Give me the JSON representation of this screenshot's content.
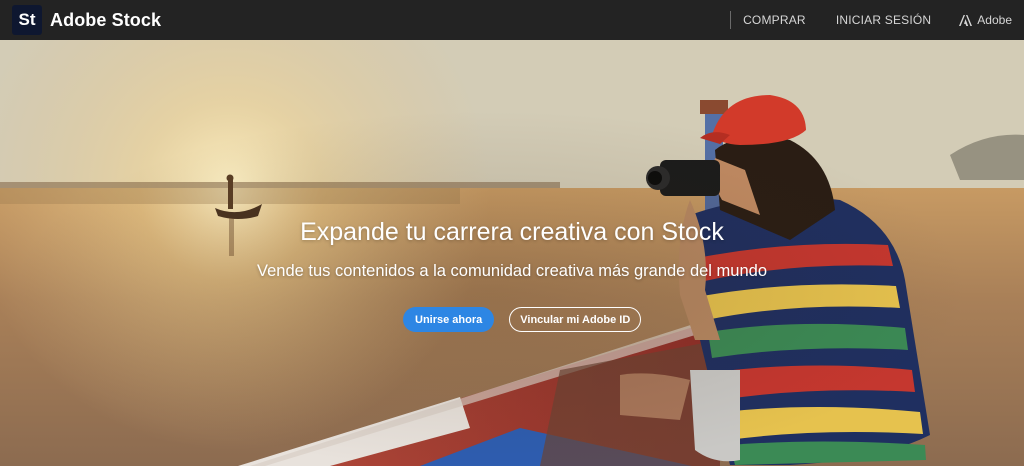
{
  "header": {
    "logo_mark": "St",
    "brand_name": "Adobe Stock",
    "nav": {
      "buy_label": "COMPRAR",
      "signin_label": "INICIAR SESIÓN",
      "adobe_label": "Adobe"
    }
  },
  "hero": {
    "headline": "Expande tu carrera creativa con Stock",
    "subheadline": "Vende tus contenidos a la comunidad creativa más grande del mundo",
    "primary_button": "Unirse ahora",
    "secondary_button": "Vincular mi Adobe ID"
  },
  "colors": {
    "topbar": "#232323",
    "logo_bg": "#0e1730",
    "primary_button": "#2d86e4"
  },
  "icons": {
    "adobe": "adobe-logo-icon"
  }
}
